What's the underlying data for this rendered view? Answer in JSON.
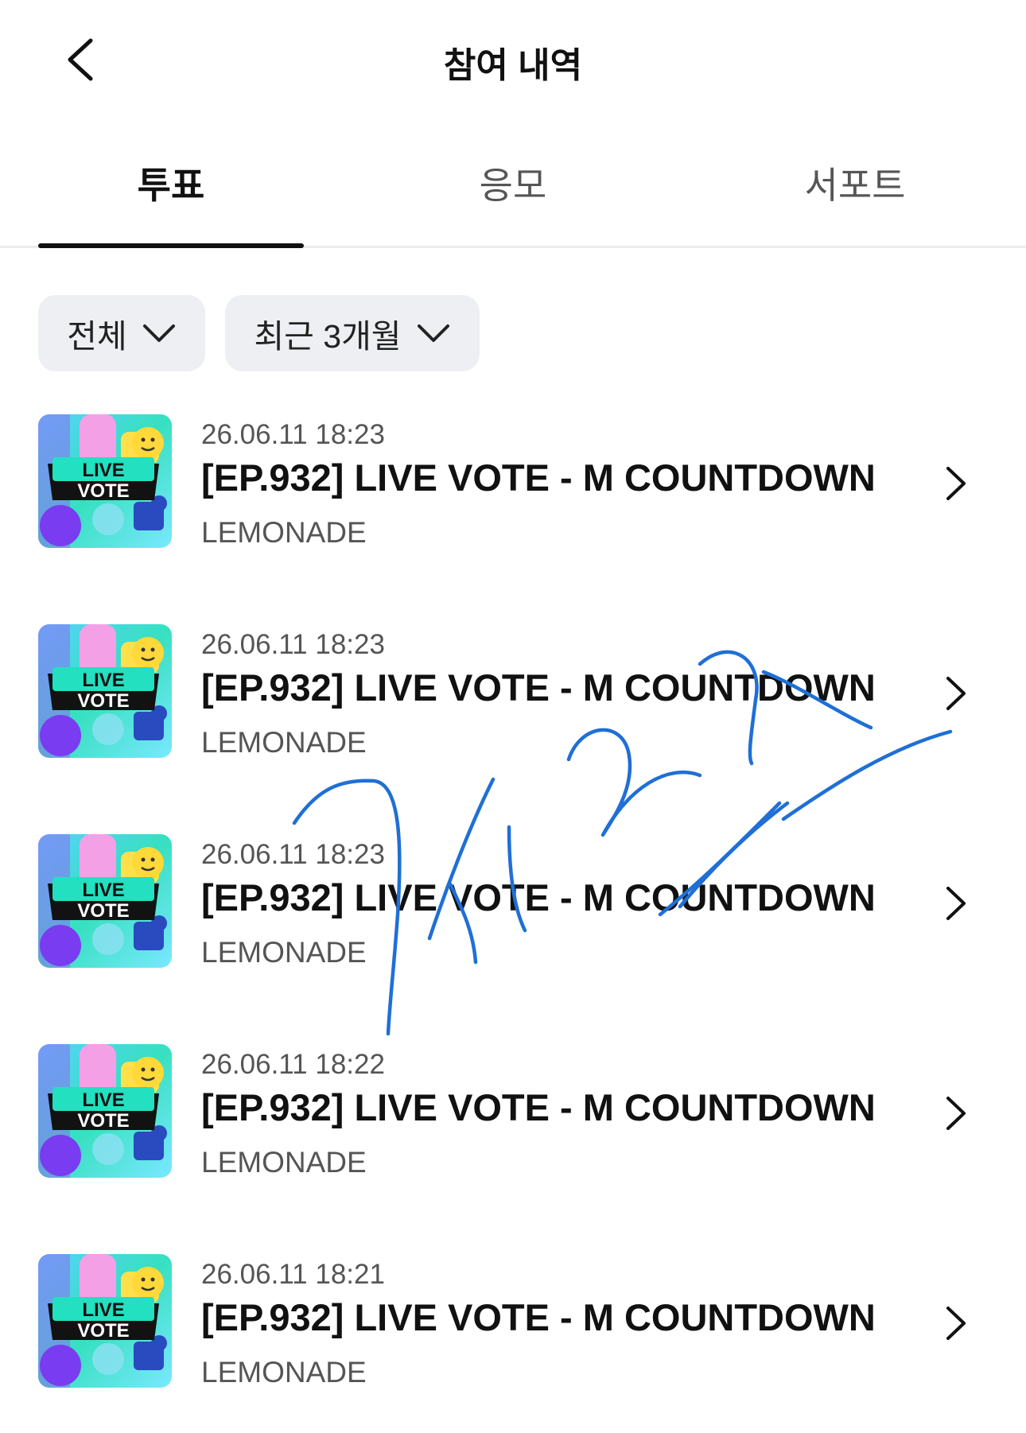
{
  "header": {
    "title": "참여 내역",
    "back_icon": "chevron-left-icon"
  },
  "tabs": [
    {
      "label": "투표",
      "active": true
    },
    {
      "label": "응모",
      "active": false
    },
    {
      "label": "서포트",
      "active": false
    }
  ],
  "filters": [
    {
      "label": "전체",
      "icon": "chevron-down-icon"
    },
    {
      "label": "최근 3개월",
      "icon": "chevron-down-icon"
    }
  ],
  "thumbnail": {
    "line1": "LIVE",
    "line2": "VOTE"
  },
  "items": [
    {
      "date": "26.06.11 18:23",
      "title": "[EP.932] LIVE VOTE - M COUNTDOWN",
      "subtitle": "LEMONADE"
    },
    {
      "date": "26.06.11 18:23",
      "title": "[EP.932] LIVE VOTE - M COUNTDOWN",
      "subtitle": "LEMONADE"
    },
    {
      "date": "26.06.11 18:23",
      "title": "[EP.932] LIVE VOTE - M COUNTDOWN",
      "subtitle": "LEMONADE"
    },
    {
      "date": "26.06.11 18:22",
      "title": "[EP.932] LIVE VOTE - M COUNTDOWN",
      "subtitle": "LEMONADE"
    },
    {
      "date": "26.06.11 18:21",
      "title": "[EP.932] LIVE VOTE - M COUNTDOWN",
      "subtitle": "LEMONADE"
    }
  ],
  "colors": {
    "accent": "#111111",
    "filter_bg": "#eeeff2",
    "scribble": "#1f6fd6"
  }
}
